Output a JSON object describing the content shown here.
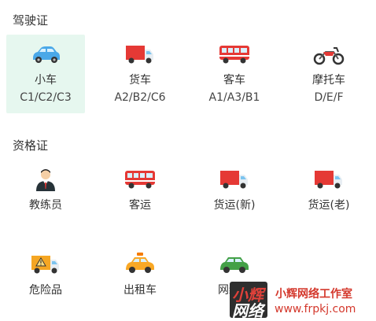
{
  "sections": {
    "license_title": "驾驶证",
    "qualification_title": "资格证"
  },
  "license": [
    {
      "label": "小车",
      "sub": "C1/C2/C3",
      "icon": "car-icon",
      "selected": true
    },
    {
      "label": "货车",
      "sub": "A2/B2/C6",
      "icon": "truck-icon",
      "selected": false
    },
    {
      "label": "客车",
      "sub": "A1/A3/B1",
      "icon": "bus-icon",
      "selected": false
    },
    {
      "label": "摩托车",
      "sub": "D/E/F",
      "icon": "motorcycle-icon",
      "selected": false
    }
  ],
  "qualification": [
    {
      "label": "教练员",
      "icon": "instructor-icon"
    },
    {
      "label": "客运",
      "icon": "bus-icon"
    },
    {
      "label": "货运(新)",
      "icon": "truck-icon"
    },
    {
      "label": "货运(老)",
      "icon": "truck-icon"
    },
    {
      "label": "危险品",
      "icon": "hazmat-truck-icon"
    },
    {
      "label": "出租车",
      "icon": "taxi-icon"
    },
    {
      "label": "网约车",
      "icon": "rideshare-car-icon"
    }
  ],
  "watermark": {
    "logo_text_1": "小辉",
    "logo_text_2": "网络",
    "name": "小辉网络工作室",
    "url": "www.frpkj.com"
  },
  "colors": {
    "selected_bg": "#e6f7ef",
    "watermark_red": "#d4382c"
  }
}
